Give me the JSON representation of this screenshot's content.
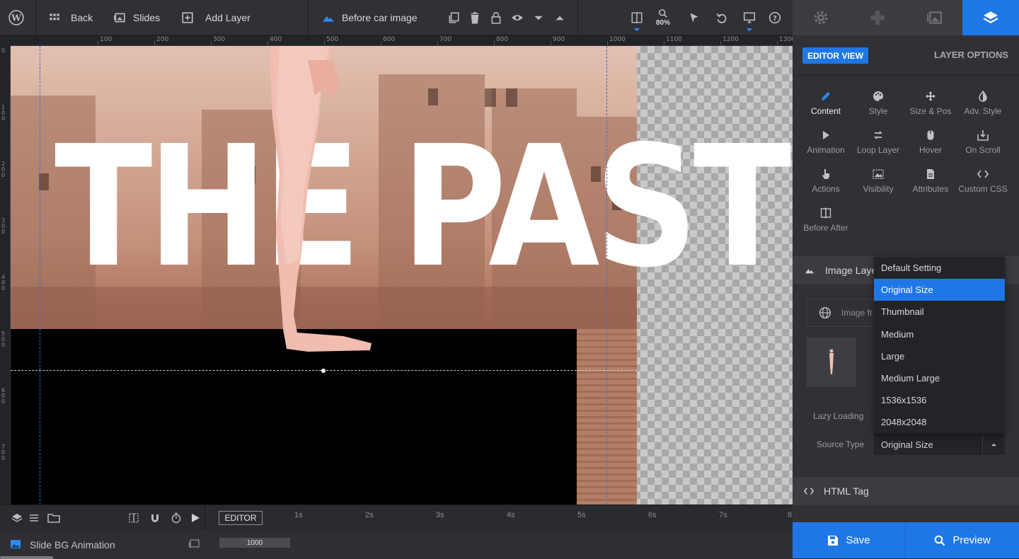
{
  "topbar": {
    "back_label": "Back",
    "slides_label": "Slides",
    "add_layer_label": "Add Layer",
    "layer_name": "Before car image",
    "zoom": "80%"
  },
  "ruler": {
    "h_labels": [
      "100",
      "200",
      "300",
      "400",
      "500",
      "600",
      "700",
      "800",
      "900",
      "1000",
      "1100",
      "1200",
      "1300"
    ],
    "v_labels": [
      "0",
      "100",
      "200",
      "300",
      "400",
      "500",
      "600",
      "700"
    ]
  },
  "canvas": {
    "headline": "THE PAST"
  },
  "timeline": {
    "editor_label": "EDITOR",
    "seconds": [
      "1s",
      "2s",
      "3s",
      "4s",
      "5s",
      "6s",
      "7s",
      "8"
    ],
    "bg_animation_label": "Slide BG Animation",
    "bar_value": "1000"
  },
  "panel": {
    "editor_view": "EDITOR VIEW",
    "layer_options": "LAYER OPTIONS",
    "options": [
      {
        "label": "Content",
        "icon": "pencil-icon"
      },
      {
        "label": "Style",
        "icon": "palette-icon"
      },
      {
        "label": "Size & Pos",
        "icon": "move-icon"
      },
      {
        "label": "Adv. Style",
        "icon": "contrast-icon"
      },
      {
        "label": "Animation",
        "icon": "play-icon"
      },
      {
        "label": "Loop Layer",
        "icon": "loop-icon"
      },
      {
        "label": "Hover",
        "icon": "mouse-icon"
      },
      {
        "label": "On Scroll",
        "icon": "scroll-download-icon"
      },
      {
        "label": "Actions",
        "icon": "hand-pointer-icon"
      },
      {
        "label": "Visibility",
        "icon": "visibility-icon"
      },
      {
        "label": "Attributes",
        "icon": "document-icon"
      },
      {
        "label": "Custom CSS",
        "icon": "code-icon"
      },
      {
        "label": "Before After",
        "icon": "split-icon"
      }
    ],
    "image_layer_label": "Image Laye",
    "image_from_label": "Image fr",
    "lazy_loading_label": "Lazy Loading",
    "source_type_label": "Source Type",
    "source_type_value": "Original Size",
    "dropdown_options": [
      "Default Setting",
      "Original Size",
      "Thumbnail",
      "Medium",
      "Large",
      "Medium Large",
      "1536x1536",
      "2048x2048"
    ],
    "html_tag_label": "HTML Tag",
    "save_label": "Save",
    "preview_label": "Preview"
  },
  "colors": {
    "accent": "#1f77e6",
    "panel_bg": "#2f3136",
    "toolbar_bg": "#2f3136"
  }
}
